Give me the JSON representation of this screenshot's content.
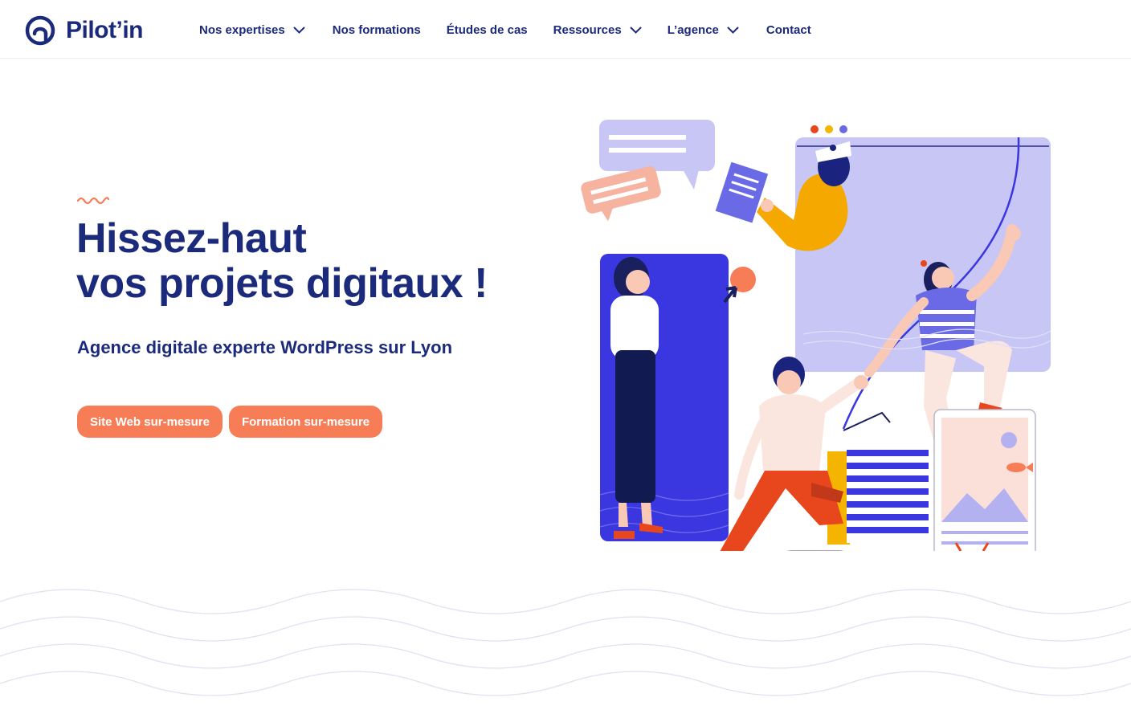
{
  "brand": {
    "name": "Pilot’in",
    "logo_icon": "helm-circle-icon",
    "color": "#1c2a7b"
  },
  "nav": {
    "items": [
      {
        "label": "Nos expertises",
        "has_dropdown": true
      },
      {
        "label": "Nos formations",
        "has_dropdown": false
      },
      {
        "label": "Études de cas",
        "has_dropdown": false
      },
      {
        "label": "Ressources",
        "has_dropdown": true
      },
      {
        "label": "L’agence",
        "has_dropdown": true
      },
      {
        "label": "Contact",
        "has_dropdown": false
      }
    ]
  },
  "hero": {
    "headline_line1": "Hissez-haut",
    "headline_line2": "vos projets digitaux !",
    "subtitle": "Agence digitale experte WordPress sur Lyon",
    "cta_primary": "Site Web sur-mesure",
    "cta_secondary": "Formation sur-mesure"
  },
  "colors": {
    "primary": "#1c2a7b",
    "accent": "#f77d57",
    "lavender": "#c7c6f5",
    "blue": "#3a36e0",
    "yellow": "#f5b400",
    "red": "#e8461c"
  }
}
